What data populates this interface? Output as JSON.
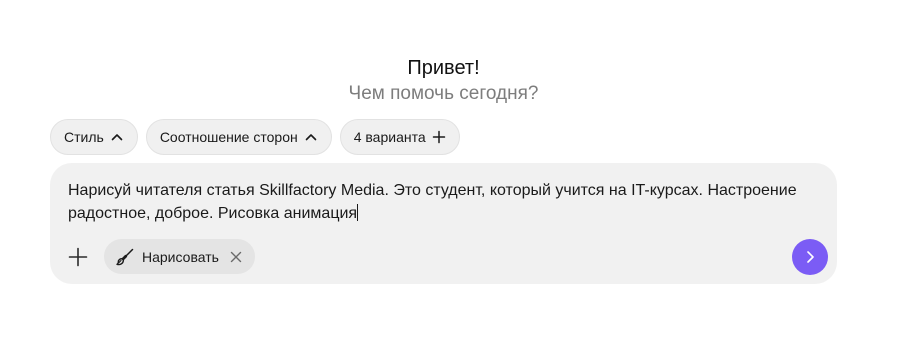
{
  "greeting": {
    "title": "Привет!",
    "subtitle": "Чем помочь сегодня?"
  },
  "chips": [
    {
      "label": "Стиль",
      "icon": "chevron-up-icon"
    },
    {
      "label": "Соотношение сторон",
      "icon": "chevron-up-icon"
    },
    {
      "label": "4 варианта",
      "icon": "plus-icon"
    }
  ],
  "composer": {
    "text": "Нарисуй читателя статья Skillfactory Media. Это студент, который учится на IT-курсах. Настроение радостное, доброе. Рисовка анимация",
    "tool_chip": {
      "label": "Нарисовать",
      "icon": "paintbrush-icon"
    },
    "add_icon": "plus-icon",
    "send_icon": "chevron-right-icon"
  },
  "colors": {
    "accent": "#7b5cf5",
    "composer_bg": "#f1f1f1",
    "chip_bg": "#f0f0f0",
    "subtitle": "#7d7d7d"
  }
}
